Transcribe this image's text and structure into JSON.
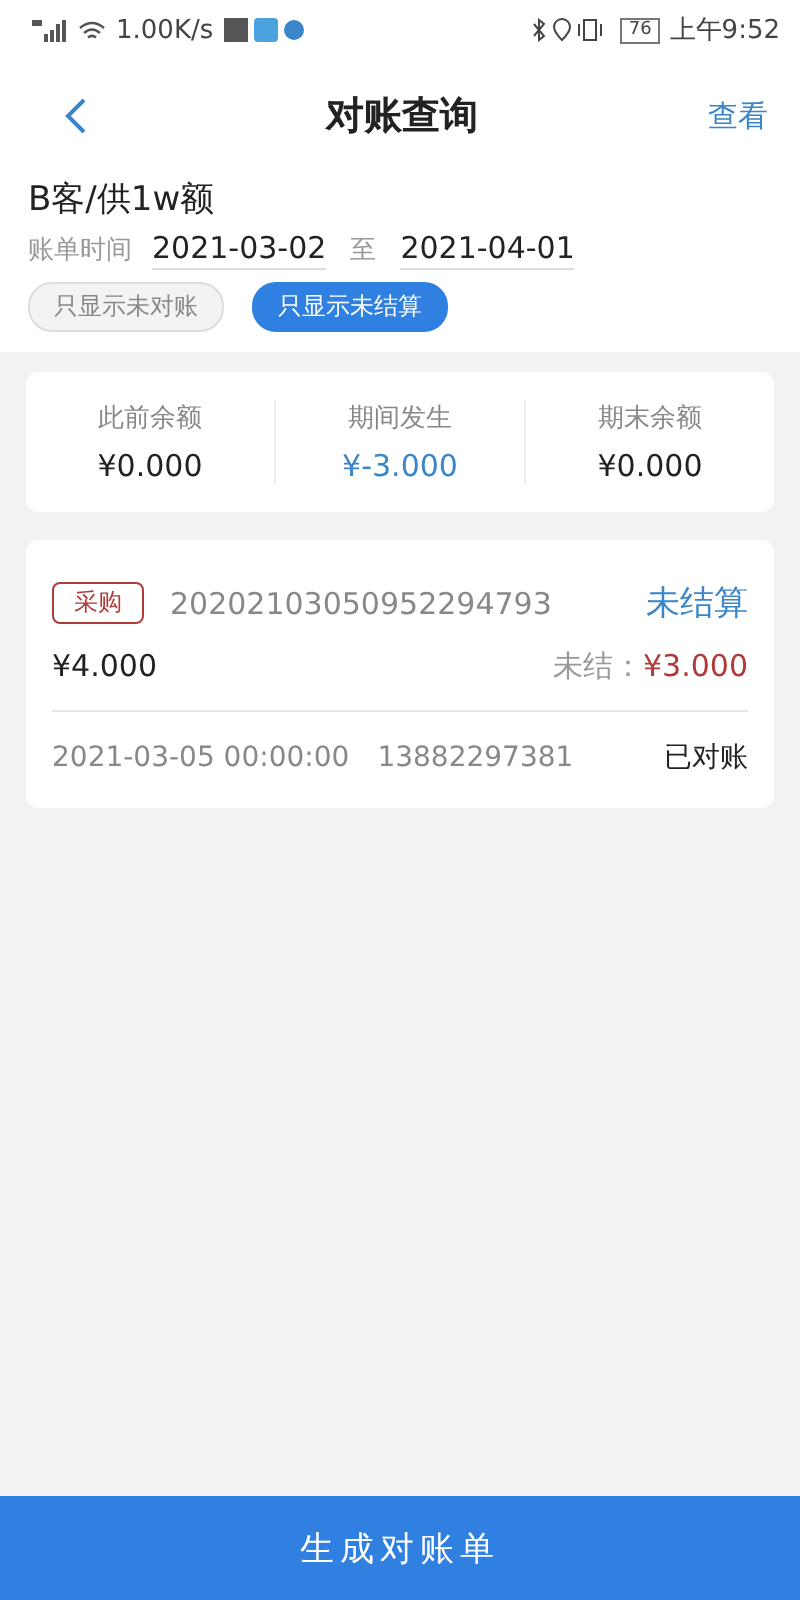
{
  "status_bar": {
    "network": "1.00K/s",
    "battery": "76",
    "time": "上午9:52"
  },
  "header": {
    "title": "对账查询",
    "action": "查看"
  },
  "customer": "B客/供1w额",
  "period": {
    "label": "账单时间",
    "start": "2021-03-02",
    "separator": "至",
    "end": "2021-04-01"
  },
  "filters": [
    {
      "label": "只显示未对账",
      "selected": false
    },
    {
      "label": "只显示未结算",
      "selected": true
    }
  ],
  "summary": [
    {
      "label": "此前余额",
      "value": "¥0.000",
      "color": "#222222"
    },
    {
      "label": "期间发生",
      "value": "¥-3.000",
      "color": "#3a86c8"
    },
    {
      "label": "期末余额",
      "value": "¥0.000",
      "color": "#222222"
    }
  ],
  "records": [
    {
      "tag": "采购",
      "number": "20202103050952294793",
      "status": "未结算",
      "amount": "¥4.000",
      "unsettled_label": "未结：",
      "unsettled_value": "¥3.000",
      "datetime": "2021-03-05 00:00:00",
      "phone": "13882297381",
      "reconcile": "已对账"
    }
  ],
  "footer_button": "生成对账单"
}
